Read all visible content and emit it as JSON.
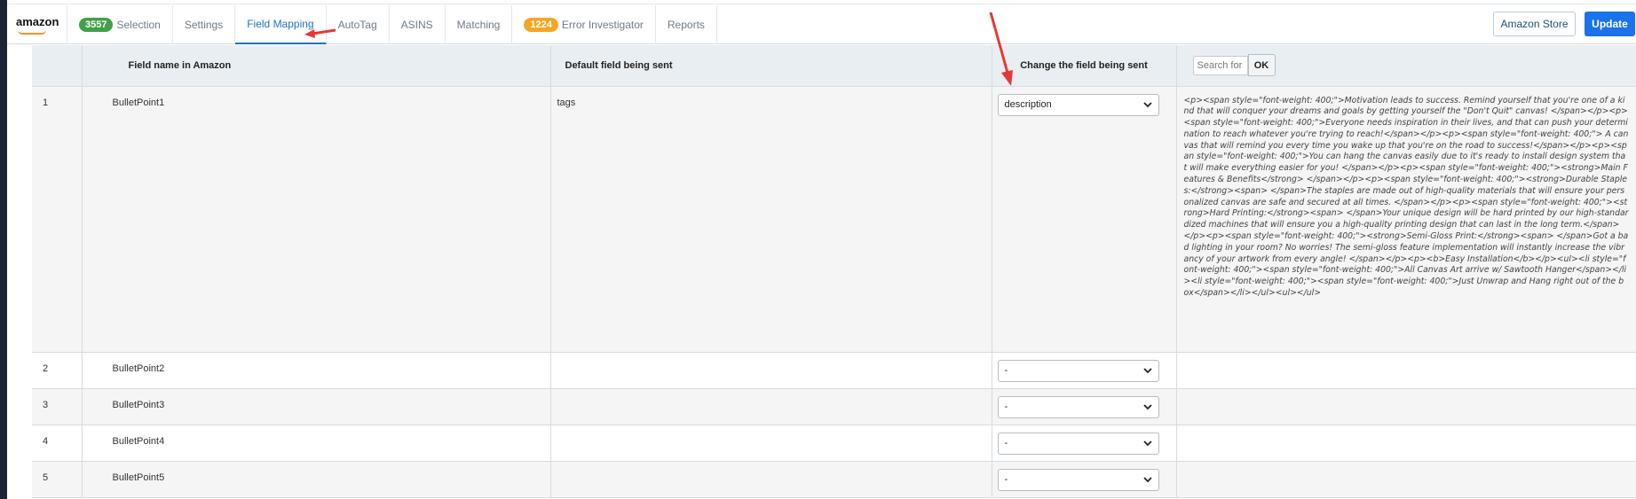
{
  "nav": {
    "logo": "amazon",
    "tabs": [
      {
        "label": "Selection",
        "badge": "3557",
        "badge_color": "#43a047"
      },
      {
        "label": "Settings"
      },
      {
        "label": "Field Mapping",
        "active": true
      },
      {
        "label": "AutoTag"
      },
      {
        "label": "ASINS"
      },
      {
        "label": "Matching"
      },
      {
        "label": "Error Investigator",
        "badge": "1224",
        "badge_color": "#f5a623"
      },
      {
        "label": "Reports"
      }
    ],
    "store_button": "Amazon Store",
    "update_button": "Update"
  },
  "table": {
    "headers": {
      "name": "Field name in Amazon",
      "default": "Default field being sent",
      "change": "Change the field being sent"
    },
    "search": {
      "placeholder": "Search for",
      "ok": "OK"
    },
    "rows": [
      {
        "index": "1",
        "name": "BulletPoint1",
        "default": "tags",
        "change": "description",
        "preview": "<p><span style=\"font-weight: 400;\">Motivation leads to success. Remind yourself that you're one of a kind that will conquer your dreams and goals by getting yourself the \"Don't Quit\" canvas! </span></p><p><span style=\"font-weight: 400;\">Everyone needs inspiration in their lives, and that can push your determination to reach whatever you're trying to reach!</span></p><p><span style=\"font-weight: 400;\"> A canvas that will remind you every time you wake up that you're on the road to success!</span></p><p><span style=\"font-weight: 400;\">You can hang the canvas easily due to it's ready to install design system that will make everything easier for you! </span></p><p><span style=\"font-weight: 400;\"><strong>Main Features & Benefits</strong> </span></p><p><span style=\"font-weight: 400;\"><strong>Durable Staples:</strong><span> </span>The staples are made out of high-quality materials that will ensure your personalized canvas are safe and secured at all times. </span></p><p><span style=\"font-weight: 400;\"><strong>Hard Printing:</strong><span> </span>Your unique design will be hard printed by our high-standardized machines that will ensure you a high-quality printing design that can last in the long term.</span></p><p><span style=\"font-weight: 400;\"><strong>Semi-Gloss Print:</strong><span> </span>Got a bad lighting in your room? No worries! The semi-gloss feature implementation will instantly increase the vibrancy of your artwork from every angle! </span></p><p><b>Easy Installation</b></p><ul><li style=\"font-weight: 400;\"><span style=\"font-weight: 400;\">All Canvas Art arrive w/ Sawtooth Hanger</span></li><li style=\"font-weight: 400;\"><span style=\"font-weight: 400;\">Just Unwrap and Hang right out of the box</span></li></ul><ul></ul>"
      },
      {
        "index": "2",
        "name": "BulletPoint2",
        "default": "",
        "change": "-",
        "preview": ""
      },
      {
        "index": "3",
        "name": "BulletPoint3",
        "default": "",
        "change": "-",
        "preview": ""
      },
      {
        "index": "4",
        "name": "BulletPoint4",
        "default": "",
        "change": "-",
        "preview": ""
      },
      {
        "index": "5",
        "name": "BulletPoint5",
        "default": "",
        "change": "-",
        "preview": ""
      }
    ]
  },
  "colors": {
    "accent": "#1f73b7",
    "update": "#1a73e8",
    "annotation_arrow": "#e53935"
  }
}
